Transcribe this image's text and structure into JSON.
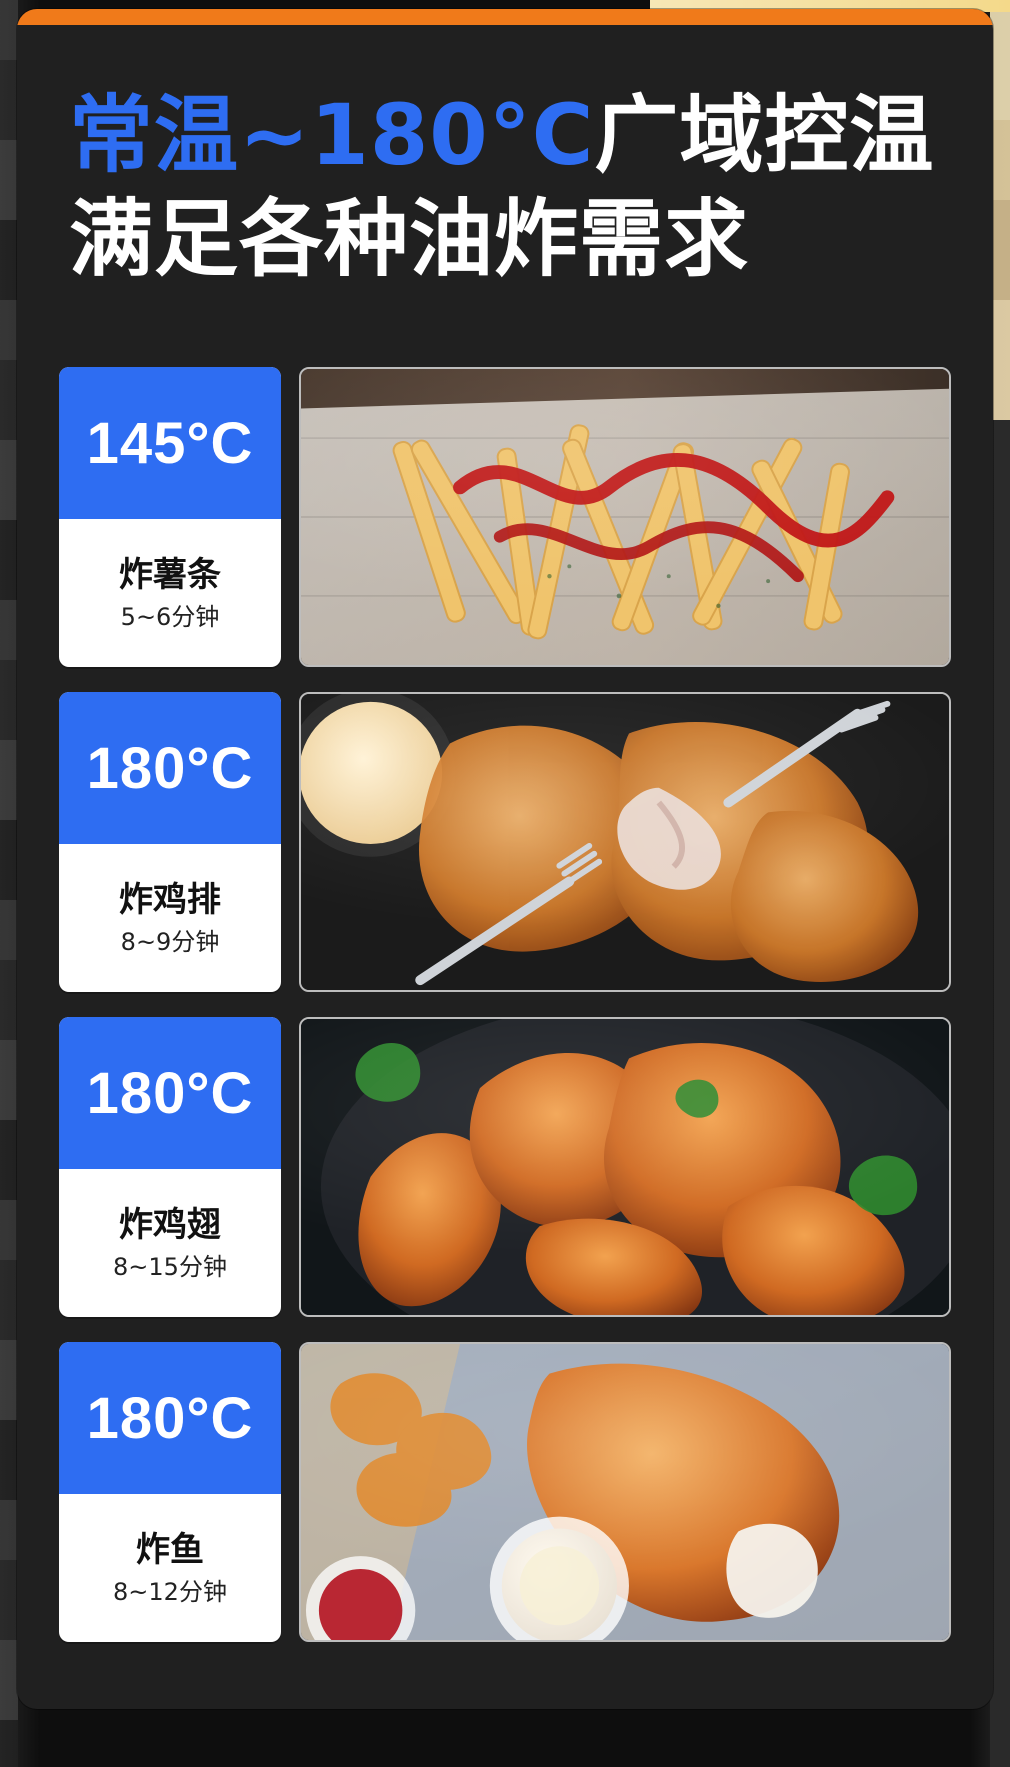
{
  "headline": {
    "line1_accent": "常温~180°C",
    "line1_rest": "广域控温",
    "line2": "满足各种油炸需求"
  },
  "items": [
    {
      "temp": "145°C",
      "name": "炸薯条",
      "time": "5~6分钟",
      "photo_icon": "french-fries-photo"
    },
    {
      "temp": "180°C",
      "name": "炸鸡排",
      "time": "8~9分钟",
      "photo_icon": "fried-chicken-cutlet-photo"
    },
    {
      "temp": "180°C",
      "name": "炸鸡翅",
      "time": "8~15分钟",
      "photo_icon": "fried-chicken-wings-photo"
    },
    {
      "temp": "180°C",
      "name": "炸鱼",
      "time": "8~12分钟",
      "photo_icon": "fried-fish-photo"
    }
  ],
  "colors": {
    "accent_blue": "#2e6df2",
    "top_bar_orange": "#f07a1a",
    "card_bg": "#202020"
  }
}
